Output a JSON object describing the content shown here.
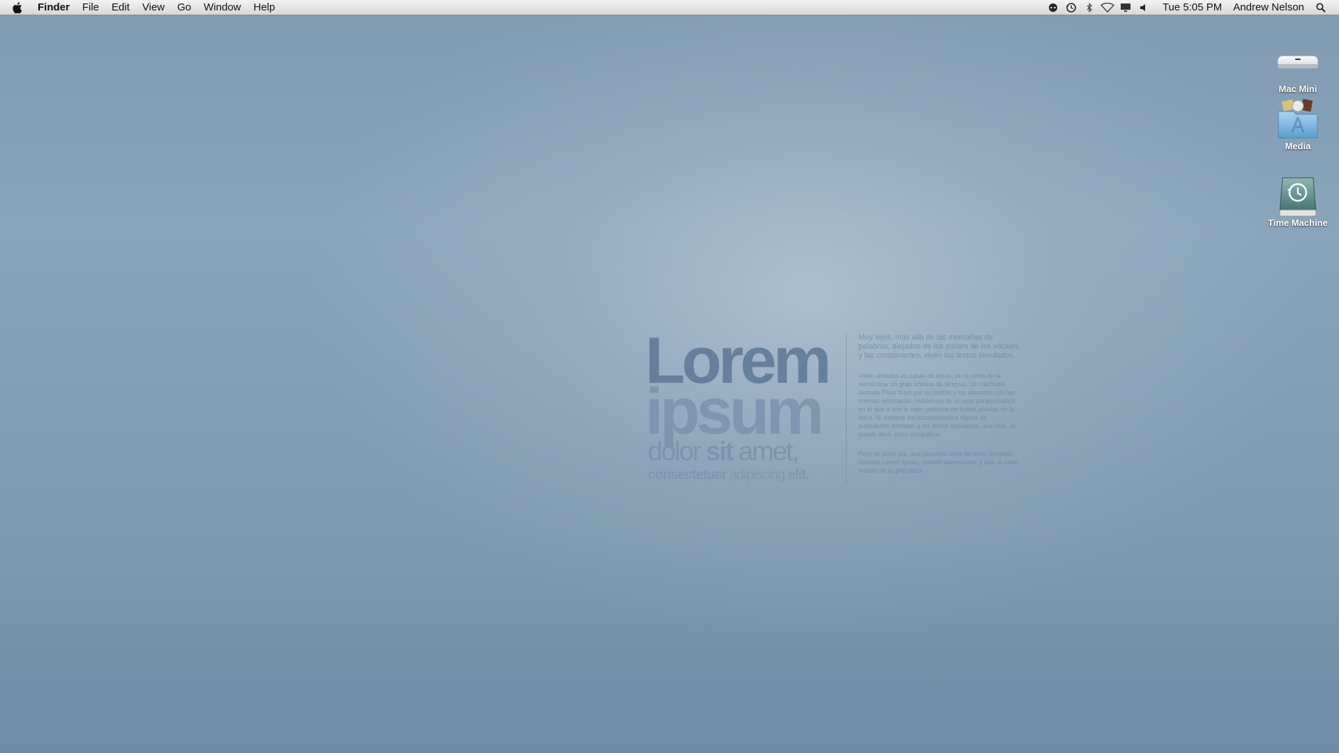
{
  "menubar": {
    "app_name": "Finder",
    "menus": [
      "File",
      "Edit",
      "View",
      "Go",
      "Window",
      "Help"
    ],
    "status_icons": [
      "messages-icon",
      "time-machine-icon",
      "bluetooth-icon",
      "wifi-icon",
      "display-icon",
      "volume-icon"
    ],
    "clock": "Tue 5:05 PM",
    "user": "Andrew Nelson"
  },
  "desktop_icons": [
    {
      "label": "Mac Mini",
      "icon": "mac-mini-icon"
    },
    {
      "label": "Media",
      "icon": "applications-folder-icon"
    },
    {
      "label": "Time Machine",
      "icon": "time-machine-drive-icon"
    }
  ],
  "wallpaper": {
    "line1": "Lorem",
    "line2": "ipsum",
    "line3_a": "dolor",
    "line3_b": "sit",
    "line3_c": "amet,",
    "line4_a": "consectetuer",
    "line4_b": "adipiscing",
    "line4_c": "elit.",
    "p1": "Muy lejos, más allá de las montañas de palabras, alejados de los países de las vocales y las consonantes, viven los textos simulados.",
    "p2": "Viven aislados en casas de letras, en la costa de la semántica, un gran océano de lenguas. Un riachuelo llamado Pons fluye por su pueblo y los abastece con las normas necesarias. Hablamos de un país paraisomático en el que a uno le caen pedazos de frases asadas en la boca. Ni siquiera los todopoderosos signos de puntuación dominan a los textos simulados; una vida, se puede decir, poco ortográfica.",
    "p3": "Pero un buen día, una pequeña línea de texto simulado, llamada Lorem Ipsum, decidió aventurarse y salir al vasto mundo de la gramática."
  },
  "colors": {
    "menubar": "#e6e6e6",
    "desktop": "#86a1b7",
    "wallpaper_text": "#5f7c96"
  }
}
